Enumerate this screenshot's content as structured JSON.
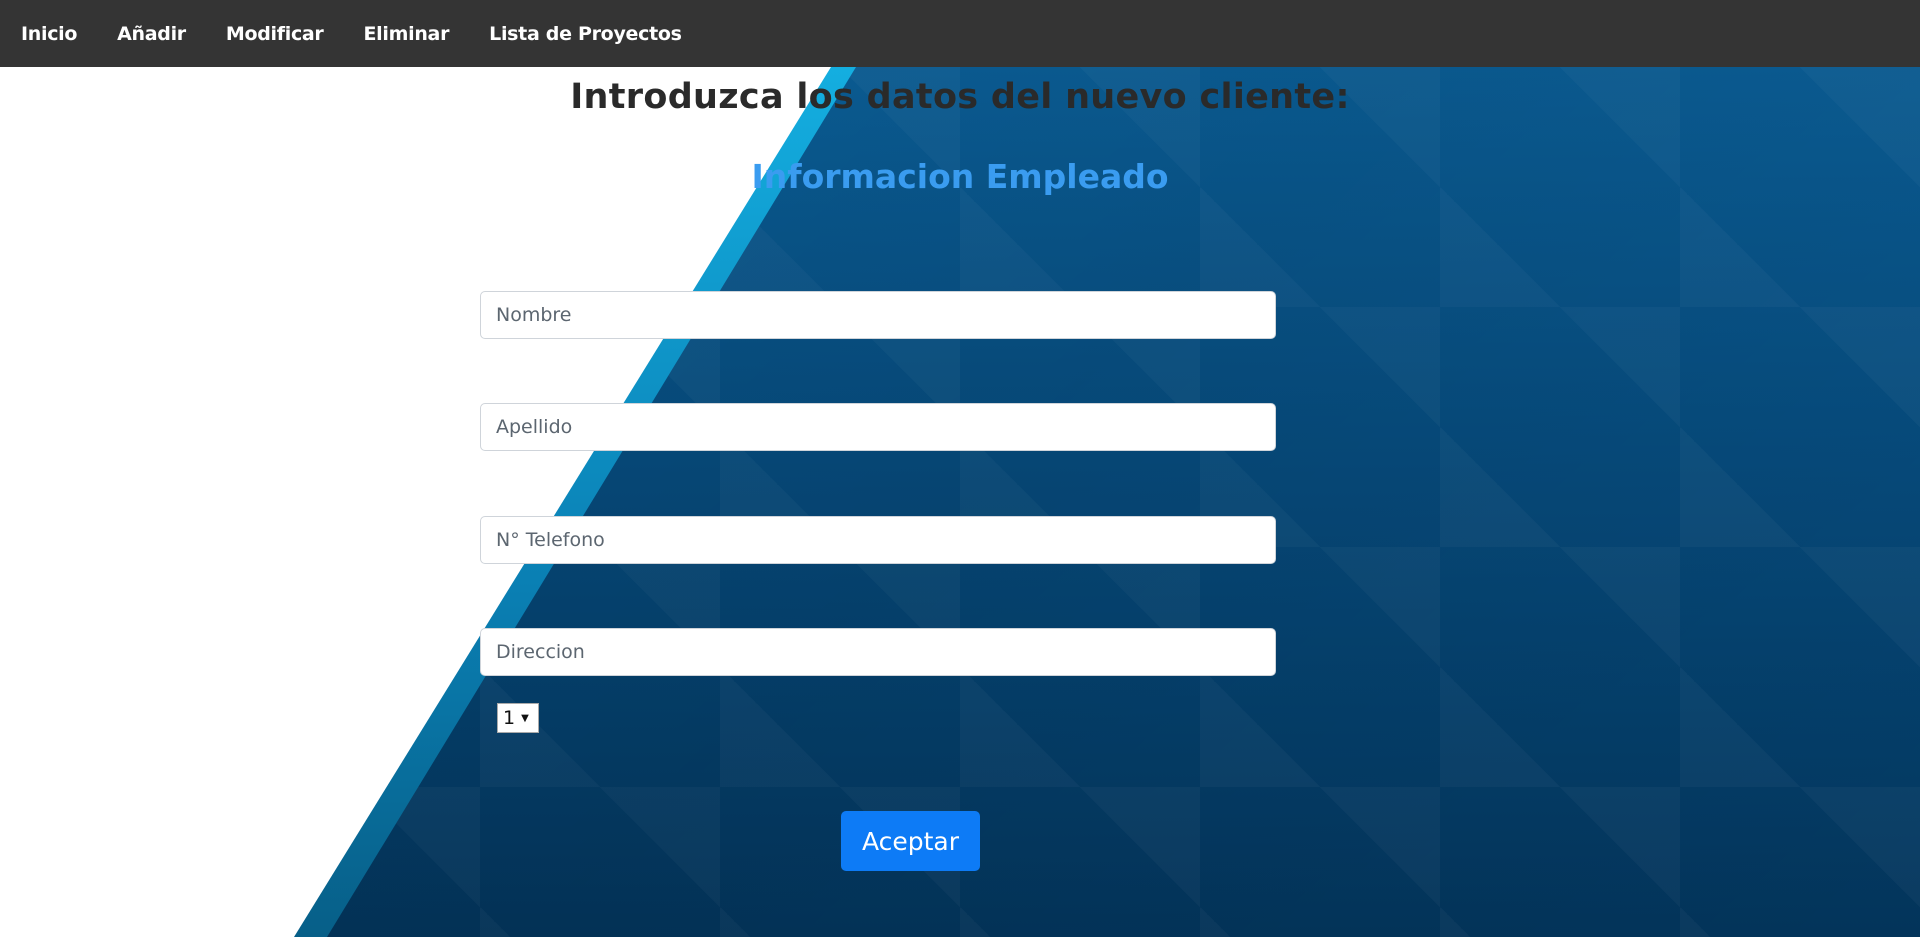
{
  "nav": {
    "items": [
      "Inicio",
      "Añadir",
      "Modificar",
      "Eliminar",
      "Lista de Proyectos"
    ]
  },
  "form": {
    "title": "Introduzca los datos del nuevo cliente:",
    "subtitle": "Informacion Empleado",
    "fields": [
      {
        "placeholder": "Nombre"
      },
      {
        "placeholder": "Apellido"
      },
      {
        "placeholder": "N° Telefono"
      },
      {
        "placeholder": "Direccion"
      }
    ],
    "select_value": "1",
    "submit_label": "Aceptar"
  },
  "colors": {
    "navbar": "#343434",
    "subtitle": "#3a9cf0",
    "button": "#0d7bf6",
    "background_blue": "#064a7b"
  }
}
